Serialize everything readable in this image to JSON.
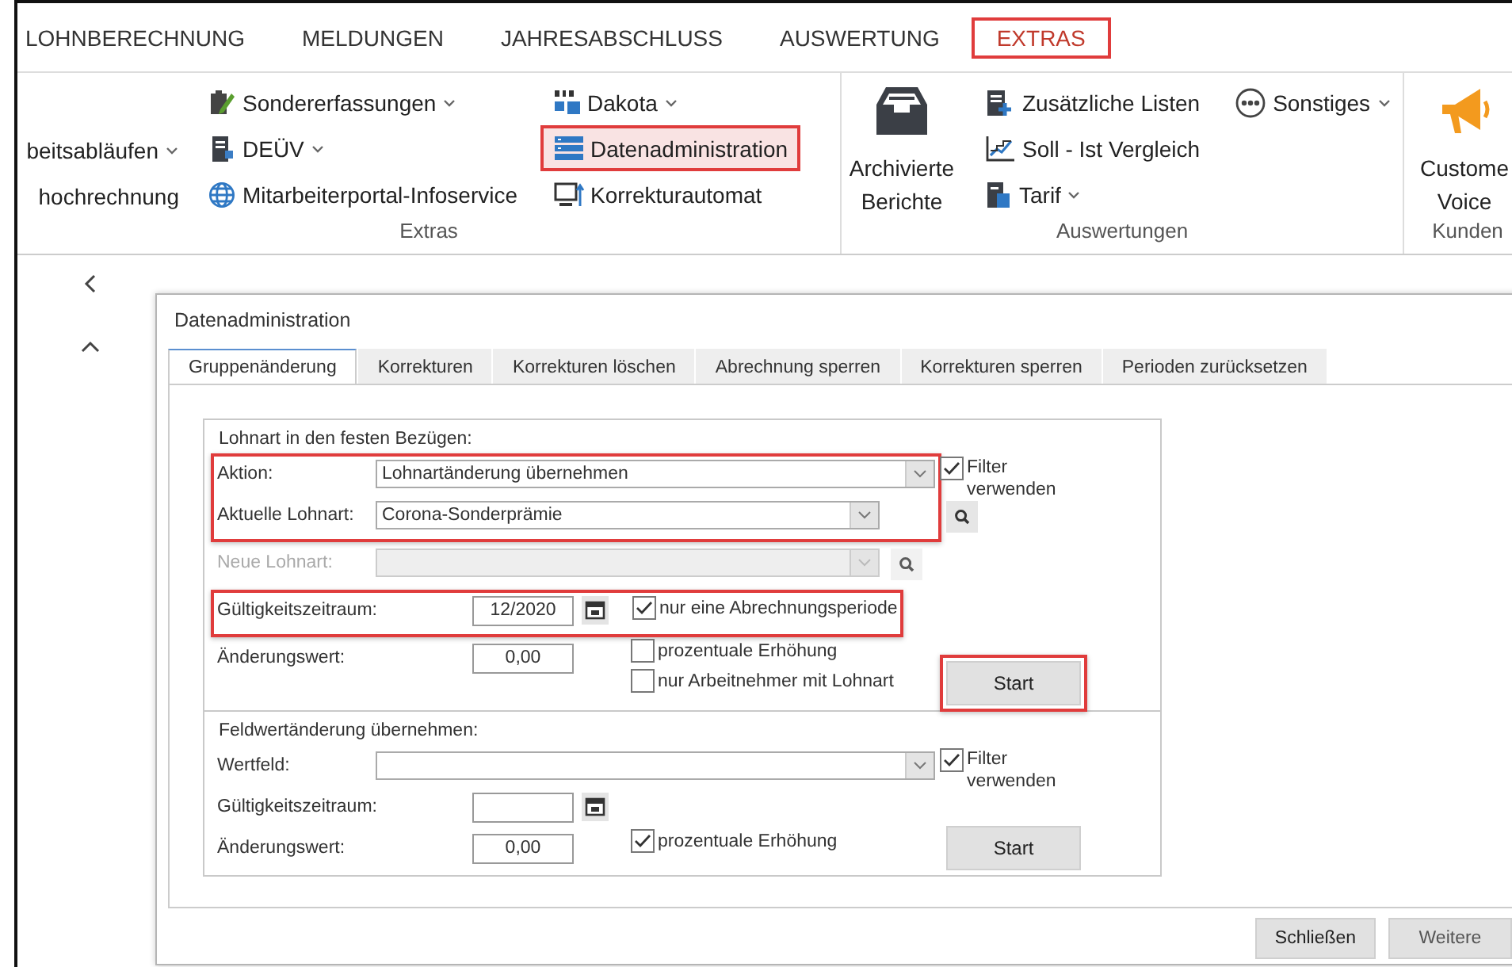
{
  "ribbon": {
    "tabs": [
      {
        "label": "LOHNBERECHNUNG",
        "selected": false,
        "highlighted": false
      },
      {
        "label": "MELDUNGEN",
        "selected": false,
        "highlighted": false
      },
      {
        "label": "JAHRESABSCHLUSS",
        "selected": false,
        "highlighted": false
      },
      {
        "label": "AUSWERTUNG",
        "selected": false,
        "highlighted": false
      },
      {
        "label": "EXTRAS",
        "selected": true,
        "highlighted": true
      }
    ],
    "groups": [
      {
        "label": "Extras",
        "columns": [
          {
            "kind": "small",
            "items": [
              {
                "label": "beitsabläufen",
                "dropdown": true,
                "highlighted": false
              },
              {
                "label": "hochrechnung",
                "dropdown": false,
                "highlighted": false
              }
            ]
          },
          {
            "kind": "small",
            "items": [
              {
                "label": "Sondererfassungen",
                "dropdown": true,
                "highlighted": false
              },
              {
                "label": "DEÜV",
                "dropdown": true,
                "highlighted": false
              },
              {
                "label": "Mitarbeiterportal-Infoservice",
                "dropdown": false,
                "highlighted": false
              }
            ]
          },
          {
            "kind": "small",
            "items": [
              {
                "label": "Dakota",
                "dropdown": true,
                "highlighted": false
              },
              {
                "label": "Datenadministration",
                "dropdown": false,
                "highlighted": true
              },
              {
                "label": "Korrekturautomat",
                "dropdown": false,
                "highlighted": false
              }
            ]
          }
        ]
      },
      {
        "label": "Auswertungen",
        "columns": [
          {
            "kind": "large",
            "items": [
              {
                "label": "Archivierte Berichte",
                "dropdown": false,
                "highlighted": false
              }
            ]
          },
          {
            "kind": "small",
            "items": [
              {
                "label": "Zusätzliche Listen",
                "dropdown": false,
                "highlighted": false
              },
              {
                "label": "Soll - Ist Vergleich",
                "dropdown": false,
                "highlighted": false
              },
              {
                "label": "Tarif",
                "dropdown": true,
                "highlighted": false
              }
            ]
          },
          {
            "kind": "small",
            "items": [
              {
                "label": "Sonstiges",
                "dropdown": true,
                "highlighted": false
              }
            ]
          }
        ]
      },
      {
        "label": "Kunden",
        "columns": [
          {
            "kind": "large",
            "items": [
              {
                "label": "Custome Voice",
                "dropdown": false,
                "highlighted": false
              }
            ]
          }
        ]
      }
    ]
  },
  "dialog": {
    "title": "Datenadministration",
    "tabs": [
      {
        "label": "Gruppenänderung",
        "selected": true
      },
      {
        "label": "Korrekturen",
        "selected": false
      },
      {
        "label": "Korrekturen löschen",
        "selected": false
      },
      {
        "label": "Abrechnung sperren",
        "selected": false
      },
      {
        "label": "Korrekturen sperren",
        "selected": false
      },
      {
        "label": "Perioden zurücksetzen",
        "selected": false
      }
    ],
    "sections": [
      {
        "title": "Lohnart in den festen Bezügen:",
        "blocks": [
          {
            "highlighted": true,
            "rows": [
              {
                "kind": "combo",
                "label": "Aktion:",
                "value": "Lohnartänderung übernehmen",
                "disabled": false,
                "search": false
              },
              {
                "kind": "combo",
                "label": "Aktuelle Lohnart:",
                "value": "Corona-Sonderprämie",
                "disabled": false,
                "search": true
              }
            ]
          },
          {
            "highlighted": false,
            "rows": [
              {
                "kind": "combo",
                "label": "Neue Lohnart:",
                "disabled": true,
                "search": true
              }
            ]
          },
          {
            "highlighted": true,
            "rows": [
              {
                "kind": "date",
                "label": "Gültigkeitszeitraum:",
                "value": "12/2020",
                "disabled": false,
                "checkboxes": [
                  {
                    "label": "nur eine Abrechnungsperiode",
                    "checked": true
                  }
                ]
              }
            ]
          },
          {
            "highlighted": false,
            "rows": [
              {
                "kind": "number",
                "label": "Änderungswert:",
                "value": "0,00",
                "disabled": false,
                "checkboxes": [
                  {
                    "label": "prozentuale Erhöhung",
                    "checked": false
                  },
                  {
                    "label": "nur Arbeitnehmer mit Lohnart",
                    "checked": false
                  }
                ]
              }
            ]
          }
        ],
        "filter": {
          "label": "Filter verwenden",
          "checked": true
        },
        "start": {
          "label": "Start",
          "highlighted": true
        }
      },
      {
        "title": "Feldwertänderung übernehmen:",
        "blocks": [
          {
            "highlighted": false,
            "rows": [
              {
                "kind": "combo",
                "label": "Wertfeld:",
                "disabled": false,
                "search": false
              },
              {
                "kind": "date",
                "label": "Gültigkeitszeitraum:",
                "disabled": false
              },
              {
                "kind": "number",
                "label": "Änderungswert:",
                "value": "0,00",
                "disabled": false,
                "checkboxes": [
                  {
                    "label": "prozentuale Erhöhung",
                    "checked": true
                  }
                ]
              }
            ]
          }
        ],
        "filter": {
          "label": "Filter verwenden",
          "checked": true
        },
        "start": {
          "label": "Start",
          "highlighted": false
        }
      }
    ],
    "buttons": [
      {
        "label": "Schließen"
      },
      {
        "label": "Weitere"
      }
    ]
  }
}
